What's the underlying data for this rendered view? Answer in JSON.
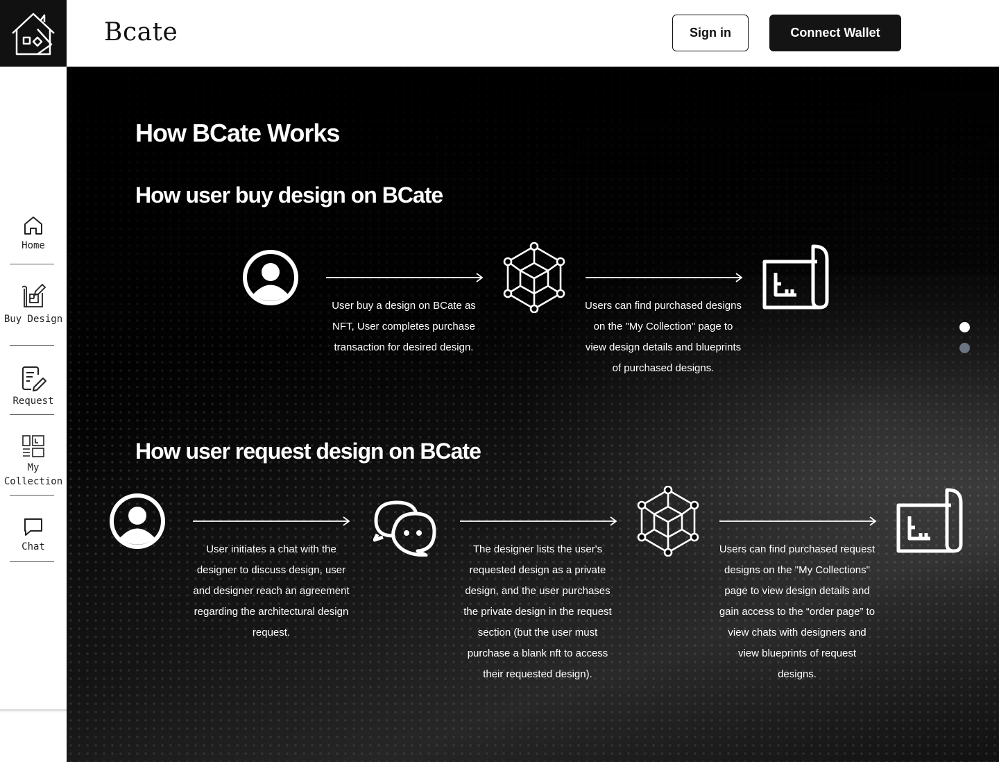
{
  "brand": {
    "name": "Bcate"
  },
  "header": {
    "signin_label": "Sign in",
    "wallet_label": "Connect Wallet"
  },
  "sidebar": {
    "items": [
      {
        "label": "Home",
        "icon": "home-icon"
      },
      {
        "label": "Buy Design",
        "icon": "blueprint-edit-icon"
      },
      {
        "label": "Request",
        "icon": "document-edit-icon"
      },
      {
        "label": "My Collection",
        "icon": "collection-icon"
      },
      {
        "label": "Chat",
        "icon": "chat-icon"
      }
    ]
  },
  "main": {
    "title": "How BCate Works",
    "buy": {
      "heading": "How user buy design on BCate",
      "steps": [
        {
          "icon": "user-avatar-icon",
          "text": ""
        },
        {
          "icon": "nft-cube-icon",
          "text": "User buy a design on BCate as NFT, User completes purchase transaction for desired design."
        },
        {
          "icon": "blueprint-icon",
          "text": "Users can find purchased designs on the \"My Collection\" page to view design details and blueprints of purchased designs."
        }
      ]
    },
    "request": {
      "heading": "How user request design on BCate",
      "steps": [
        {
          "icon": "user-avatar-icon",
          "text": "User initiates a chat with the designer to discuss design, user and designer reach an agreement regarding the architectural design request."
        },
        {
          "icon": "chat-bubbles-icon",
          "text": "The designer lists the user's requested design as a private design, and the user purchases the private design in the request section (but the user must purchase a blank nft to access their requested design)."
        },
        {
          "icon": "nft-cube-icon",
          "text": "Users can find purchased request designs on the \"My Collections\" page to view design details and gain access to the “order page” to view chats with designers and view blueprints of request designs."
        },
        {
          "icon": "blueprint-icon",
          "text": ""
        }
      ]
    }
  },
  "carousel": {
    "slides": 2,
    "active": 1
  },
  "colors": {
    "dark": "#111111",
    "accent_inactive_dot": "#6b7480",
    "text_light": "#ffffff"
  }
}
